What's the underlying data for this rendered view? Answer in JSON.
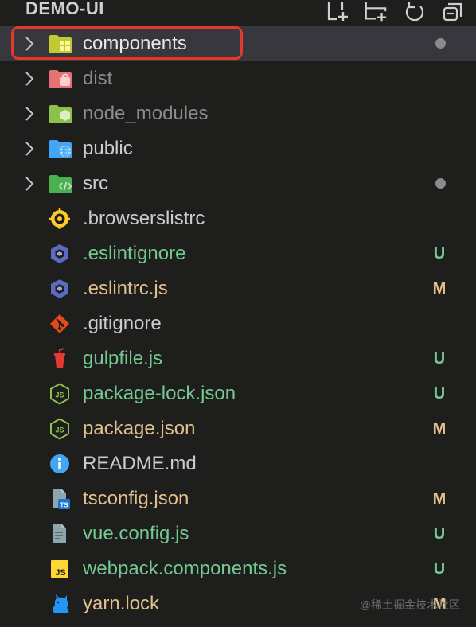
{
  "explorer": {
    "title": "DEMO-UI",
    "actions": [
      "new-file-icon",
      "new-folder-icon",
      "refresh-icon",
      "collapse-all-icon"
    ]
  },
  "colors": {
    "untracked": "#73c991",
    "modified": "#e2c08d",
    "highlight": "#e5382b",
    "selected_row": "#37373d"
  },
  "tree": [
    {
      "name": "components",
      "type": "folder",
      "icon": "folder-components-icon",
      "status": "dot",
      "selected": true
    },
    {
      "name": "dist",
      "type": "folder",
      "icon": "folder-dist-icon",
      "status": ""
    },
    {
      "name": "node_modules",
      "type": "folder",
      "icon": "folder-node-icon",
      "status": ""
    },
    {
      "name": "public",
      "type": "folder",
      "icon": "folder-public-icon",
      "status": ""
    },
    {
      "name": "src",
      "type": "folder",
      "icon": "folder-src-icon",
      "status": "dot"
    },
    {
      "name": ".browserslistrc",
      "type": "file",
      "icon": "browserslist-icon",
      "status": ""
    },
    {
      "name": ".eslintignore",
      "type": "file",
      "icon": "eslint-icon",
      "status": "U"
    },
    {
      "name": ".eslintrc.js",
      "type": "file",
      "icon": "eslint-icon",
      "status": "M"
    },
    {
      "name": ".gitignore",
      "type": "file",
      "icon": "git-icon",
      "status": ""
    },
    {
      "name": "gulpfile.js",
      "type": "file",
      "icon": "gulp-icon",
      "status": "U"
    },
    {
      "name": "package-lock.json",
      "type": "file",
      "icon": "nodejs-icon",
      "status": "U"
    },
    {
      "name": "package.json",
      "type": "file",
      "icon": "nodejs-icon",
      "status": "M"
    },
    {
      "name": "README.md",
      "type": "file",
      "icon": "info-icon",
      "status": ""
    },
    {
      "name": "tsconfig.json",
      "type": "file",
      "icon": "tsconfig-icon",
      "status": "M"
    },
    {
      "name": "vue.config.js",
      "type": "file",
      "icon": "config-file-icon",
      "status": "U"
    },
    {
      "name": "webpack.components.js",
      "type": "file",
      "icon": "js-icon",
      "status": "U"
    },
    {
      "name": "yarn.lock",
      "type": "file",
      "icon": "yarn-icon",
      "status": "M"
    }
  ],
  "watermark": "@稀土掘金技术社区"
}
